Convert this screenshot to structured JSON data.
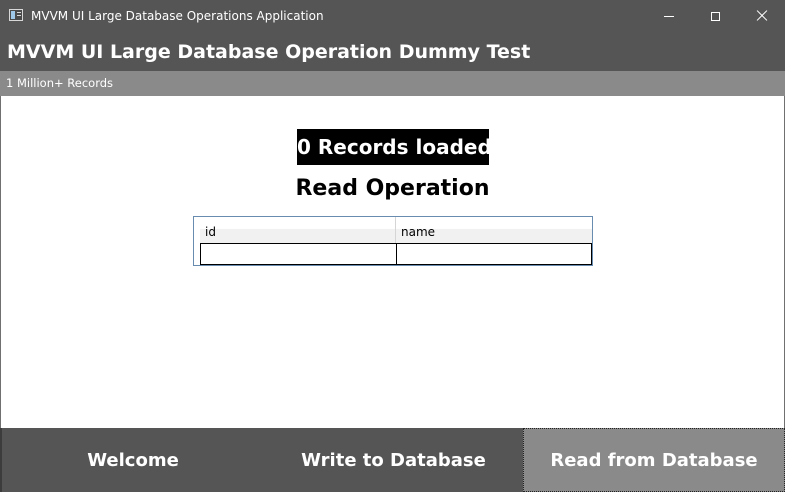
{
  "window": {
    "title": "MVVM UI Large Database Operations Application",
    "controls": [
      "minimize-icon",
      "maximize-icon",
      "close-icon"
    ]
  },
  "header": {
    "title": "MVVM UI Large Database Operation Dummy Test",
    "subtitle": "1 Million+ Records"
  },
  "main": {
    "status": "0 Records loaded.",
    "heading": "Read Operation",
    "grid": {
      "columns": [
        "id",
        "name"
      ],
      "rows": [
        [
          "",
          ""
        ]
      ]
    }
  },
  "nav": {
    "welcome": "Welcome",
    "write": "Write to Database",
    "read": "Read from Database",
    "selected": "Read from Database"
  },
  "colors": {
    "title_bar": "#555555",
    "sub_header": "#8a8a8a",
    "nav_selected": "#8a8a8a",
    "status_bg": "#000000"
  }
}
